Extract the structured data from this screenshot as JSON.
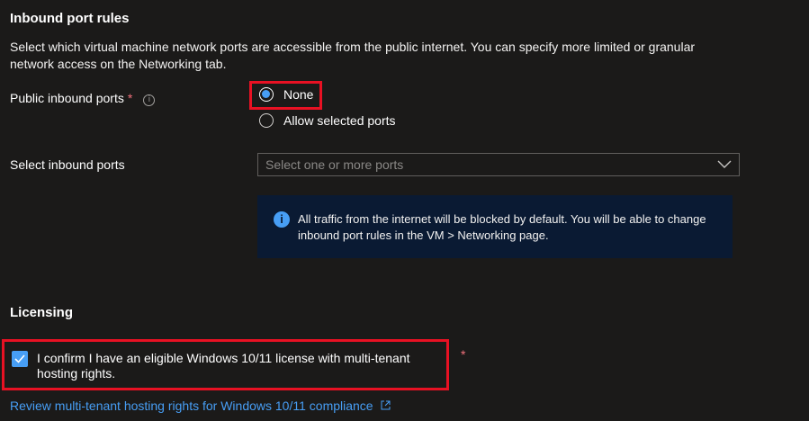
{
  "inbound": {
    "heading": "Inbound port rules",
    "description": "Select which virtual machine network ports are accessible from the public internet. You can specify more limited or granular network access on the Networking tab.",
    "public_ports_label": "Public inbound ports",
    "required_mark": "*",
    "info_glyph": "i",
    "options": [
      {
        "label": "None",
        "selected": true
      },
      {
        "label": "Allow selected ports",
        "selected": false
      }
    ],
    "select_ports_label": "Select inbound ports",
    "select_ports_placeholder": "Select one or more ports",
    "info_icon_glyph": "i",
    "info_message": "All traffic from the internet will be blocked by default. You will be able to change inbound port rules in the VM > Networking page."
  },
  "licensing": {
    "heading": "Licensing",
    "confirm_label": "I confirm I have an eligible Windows 10/11 license with multi-tenant hosting rights.",
    "confirm_checked": true,
    "required_mark": "*",
    "review_link": "Review multi-tenant hosting rights for Windows 10/11 compliance",
    "external_icon": "external-link-icon"
  },
  "colors": {
    "accent": "#479ef5",
    "highlight_border": "#e81123",
    "info_background": "#0a1a33",
    "required": "#f1707b"
  }
}
